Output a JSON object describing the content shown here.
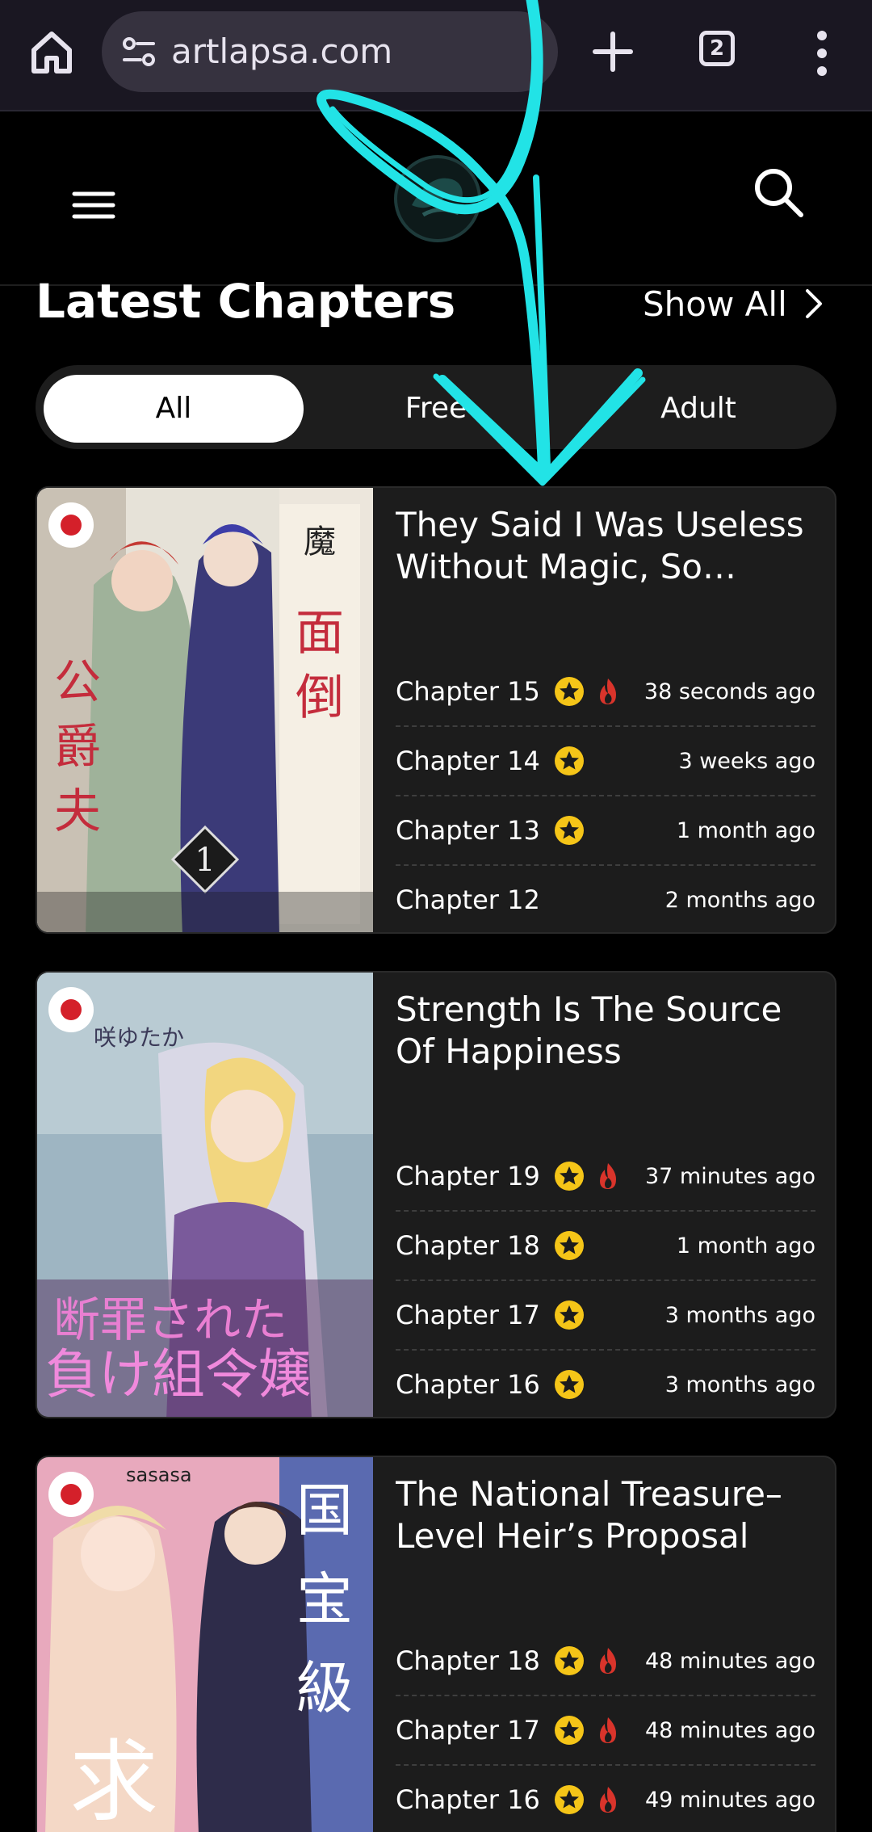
{
  "browser": {
    "url": "artlapsa.com",
    "tab_count": "2",
    "icons": [
      "home-icon",
      "site-settings-icon",
      "new-tab-icon",
      "tab-switcher-icon",
      "more-vert-icon"
    ]
  },
  "header": {
    "icons": [
      "hamburger-icon",
      "site-logo",
      "search-icon"
    ]
  },
  "section": {
    "title": "Latest Chapters",
    "show_all": "Show All"
  },
  "filters": [
    {
      "label": "All",
      "active": true
    },
    {
      "label": "Free",
      "active": false
    },
    {
      "label": "Adult",
      "active": false
    }
  ],
  "cards": [
    {
      "title": "They Said I Was Useless Without Magic, So Why Am I...",
      "title_display": "They Said I Was Useless Without Magic, So Why…",
      "chapters": [
        {
          "label": "Chapter 15",
          "star": true,
          "fire": true,
          "time": "38 seconds ago"
        },
        {
          "label": "Chapter 14",
          "star": true,
          "fire": false,
          "time": "3 weeks ago"
        },
        {
          "label": "Chapter 13",
          "star": true,
          "fire": false,
          "time": "1 month ago"
        },
        {
          "label": "Chapter 12",
          "star": false,
          "fire": false,
          "time": "2 months ago"
        }
      ]
    },
    {
      "title_display": "Strength Is The Source Of Happiness",
      "chapters": [
        {
          "label": "Chapter 19",
          "star": true,
          "fire": true,
          "time": "37 minutes ago"
        },
        {
          "label": "Chapter 18",
          "star": true,
          "fire": false,
          "time": "1 month ago"
        },
        {
          "label": "Chapter 17",
          "star": true,
          "fire": false,
          "time": "3 months ago"
        },
        {
          "label": "Chapter 16",
          "star": true,
          "fire": false,
          "time": "3 months ago"
        }
      ]
    },
    {
      "title_display": "The National Treasure–Level Heir’s Proposal",
      "chapters": [
        {
          "label": "Chapter 18",
          "star": true,
          "fire": true,
          "time": "48 minutes ago"
        },
        {
          "label": "Chapter 17",
          "star": true,
          "fire": true,
          "time": "48 minutes ago"
        },
        {
          "label": "Chapter 16",
          "star": true,
          "fire": true,
          "time": "49 minutes ago"
        }
      ]
    }
  ],
  "colors": {
    "accent_star": "#f5c518",
    "fire": "#d9342b",
    "scribble": "#22e3e6",
    "card_bg": "#1c1c1c"
  }
}
